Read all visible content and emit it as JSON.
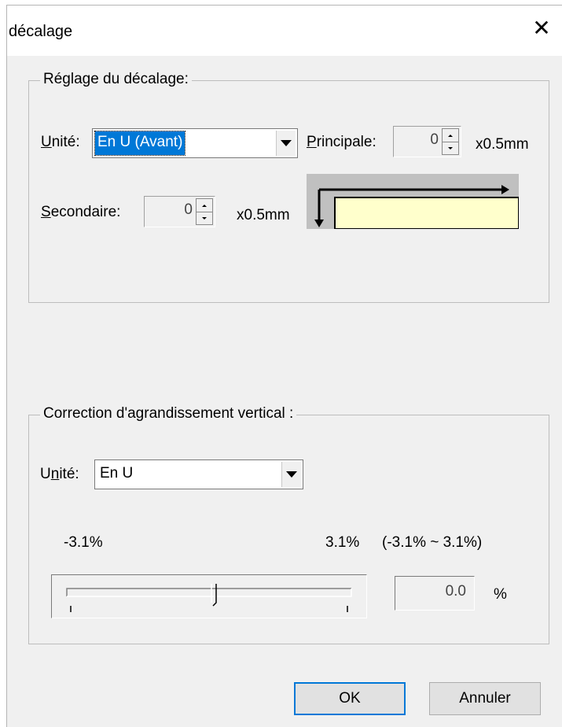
{
  "window": {
    "title": "décalage"
  },
  "offset_group": {
    "title": "Réglage du décalage:",
    "unit_label_access": "U",
    "unit_label_rest": "nité:",
    "unit_value": "En U (Avant)",
    "main_label_access": "P",
    "main_label_rest": "rincipale:",
    "main_value": "0",
    "main_unit": "x0.5mm",
    "sub_label_access": "S",
    "sub_label_rest": "econdaire:",
    "sub_value": "0",
    "sub_unit": "x0.5mm"
  },
  "magnification_group": {
    "title": "Correction d'agrandissement vertical :",
    "unit_label_pre": "U",
    "unit_label_access": "n",
    "unit_label_rest": "ité:",
    "unit_value": "En U",
    "min_label": "-3.1%",
    "max_label": "3.1%",
    "range_label": "(-3.1% ~ 3.1%)",
    "slider_fraction": 0.5,
    "value": "0.0",
    "value_unit": "%"
  },
  "buttons": {
    "ok": "OK",
    "cancel": "Annuler"
  },
  "colors": {
    "selection": "#0078d7",
    "preview_paper": "#ffffcc"
  },
  "icons": {
    "close": "close-icon",
    "dropdown": "chevron-down-icon",
    "preview": "offset-preview-icon"
  }
}
